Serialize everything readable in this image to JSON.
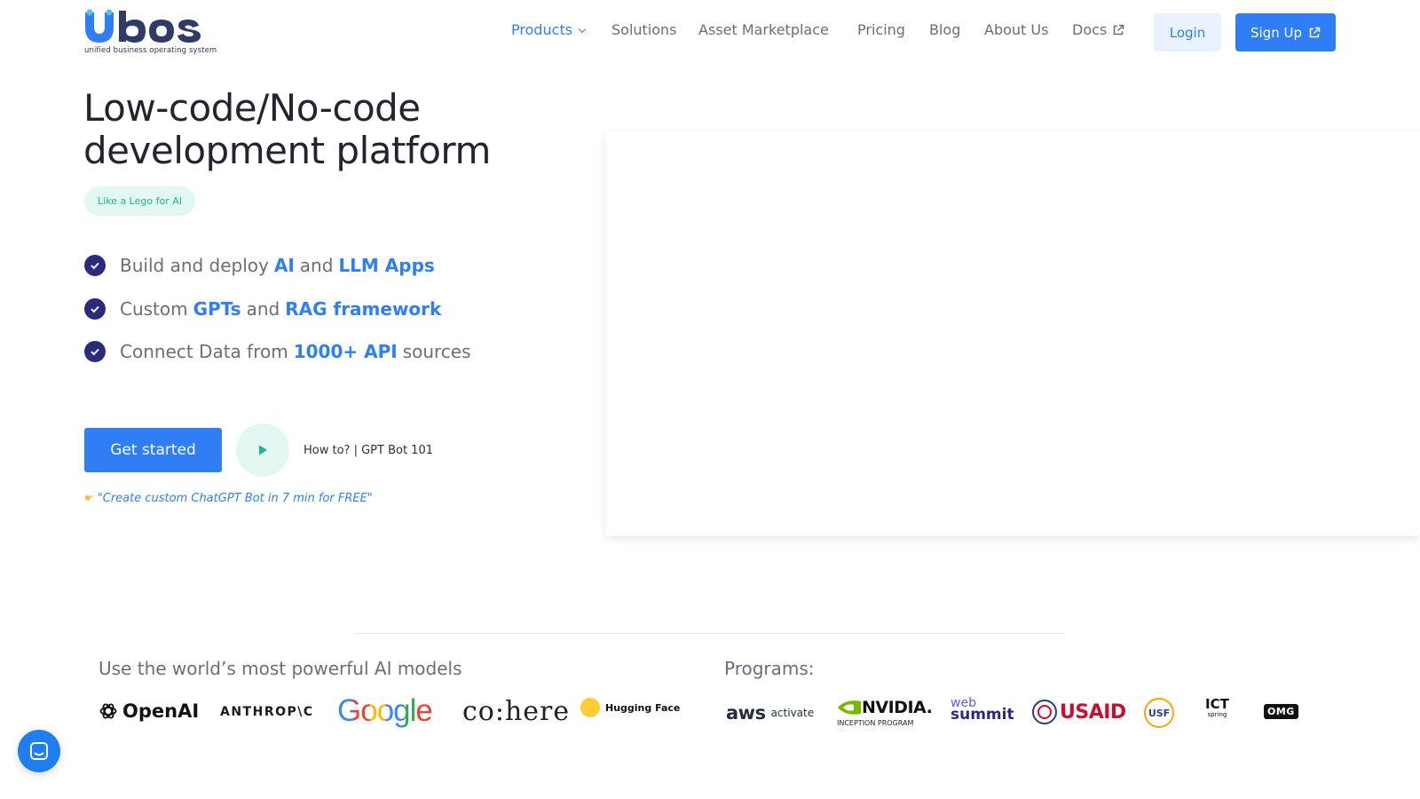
{
  "brand": {
    "name": "ubos",
    "tagline": "unified business operating system",
    "colors": {
      "primary": "#2f7ef5",
      "dark": "#2f3a66",
      "accent_teal": "#1fb398",
      "check": "#2c2a7c"
    }
  },
  "nav": {
    "products": "Products",
    "solutions": "Solutions",
    "asset_marketplace": "Asset Marketplace",
    "pricing": "Pricing",
    "blog": "Blog",
    "about": "About Us",
    "docs": "Docs",
    "login": "Login",
    "signup": "Sign Up"
  },
  "hero": {
    "title": "Low-code/No-code development platform",
    "badge": "Like a Lego for AI",
    "features": [
      {
        "text1": "Build and deploy",
        "hl1": "AI",
        "text2": "and",
        "hl2": "LLM Apps",
        "text3": ""
      },
      {
        "text1": "Custom",
        "hl1": "GPTs",
        "text2": "and",
        "hl2": "RAG framework",
        "text3": ""
      },
      {
        "text1": "Connect Data from",
        "hl1": "1000+ API",
        "text2": "sources",
        "hl2": "",
        "text3": ""
      }
    ],
    "cta": "Get started",
    "video_label": "How to? | GPT Bot 101",
    "quote": "\"Create custom ChatGPT Bot in 7 min for FREE\""
  },
  "models": {
    "title": "Use the world’s most powerful AI models",
    "logos": {
      "openai": "OpenAI",
      "anthropic": "ANTHROP\\C",
      "google": "Google",
      "cohere": "co:here",
      "huggingface": "Hugging Face"
    }
  },
  "programs": {
    "title": "Programs:",
    "logos": {
      "aws": "aws",
      "aws_sub": "activate",
      "nvidia": "NVIDIA.",
      "nvidia_sub": "INCEPTION PROGRAM",
      "websummit_1": "web",
      "websummit_2": "summit",
      "usaid": "USAID",
      "usf": "USF",
      "ict": "ICT",
      "ict_sub": "spring",
      "omg": "OMG"
    }
  },
  "icons": {
    "products_chevron": "chevron-down-icon",
    "external": "external-link-icon",
    "check": "check-circle-icon",
    "play": "play-icon",
    "hand": "pointing-hand-icon",
    "chat": "chat-icon"
  }
}
